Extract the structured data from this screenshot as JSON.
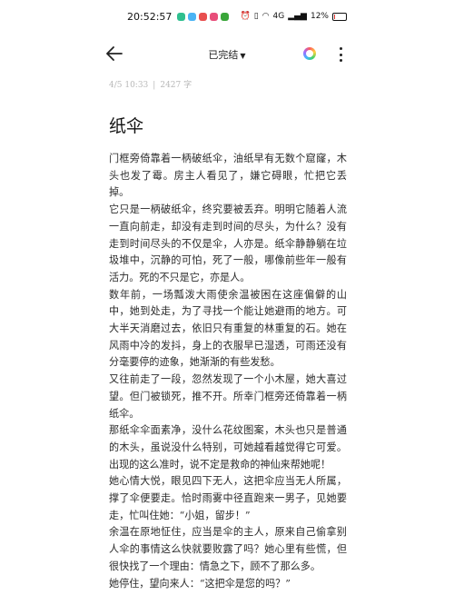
{
  "status_bar": {
    "time": "20:52:57",
    "network": "4G",
    "battery_text": "12%",
    "battery_level": 0.12,
    "app_icon_colors": [
      "#2fbf8f",
      "#4ab3f4",
      "#e84e4e",
      "#e84e7a",
      "#3aa63a"
    ]
  },
  "toolbar": {
    "title": "已完结",
    "back_icon": "back-arrow-icon",
    "theme_icon": "color-ring-icon",
    "more_icon": "more-vertical-icon"
  },
  "meta": {
    "date": "4/5 10:33",
    "word_count": "2427 字"
  },
  "document": {
    "title": "纸伞",
    "paragraphs": [
      "门框旁倚靠着一柄破纸伞，油纸早有无数个窟窿，木头也发了霉。房主人看见了，嫌它碍眼，忙把它丢掉。",
      "它只是一柄破纸伞，终究要被丢弃。明明它随着人流一直向前走，却没有走到时间的尽头，为什么？没有走到时间尽头的不仅是伞，人亦是。纸伞静静躺在垃圾堆中，沉静的可怕，死了一般，哪像前些年一般有活力。死的不只是它，亦是人。",
      "数年前，一场瓢泼大雨使余温被困在这座偏僻的山中，她到处走，为了寻找一个能让她避雨的地方。可大半天消磨过去，依旧只有重复的林重复的石。她在风雨中冷的发抖，身上的衣服早已湿透，可雨还没有分毫要停的迹象，她渐渐的有些发愁。",
      "又往前走了一段，忽然发现了一个小木屋，她大喜过望。但门被锁死，推不开。所幸门框旁还倚靠着一柄纸伞。",
      "那纸伞伞面素净，没什么花纹图案，木头也只是普通的木头，虽说没什么特别，可她越看越觉得它可爱。出现的这么准时，说不定是救命的神仙来帮她呢！",
      "她心情大悦，眼见四下无人，这把伞应当无人所属，撑了伞便要走。恰时雨雾中径直跑来一男子，见她要走，忙叫住她：“小姐，留步！”",
      "余温在原地怔住，应当是伞的主人，原来自己偷拿别人伞的事情这么快就要败露了吗？她心里有些慌，但很快找了一个理由：情急之下，顾不了那么多。",
      "她停住，望向来人：“这把伞是您的吗？”"
    ]
  }
}
